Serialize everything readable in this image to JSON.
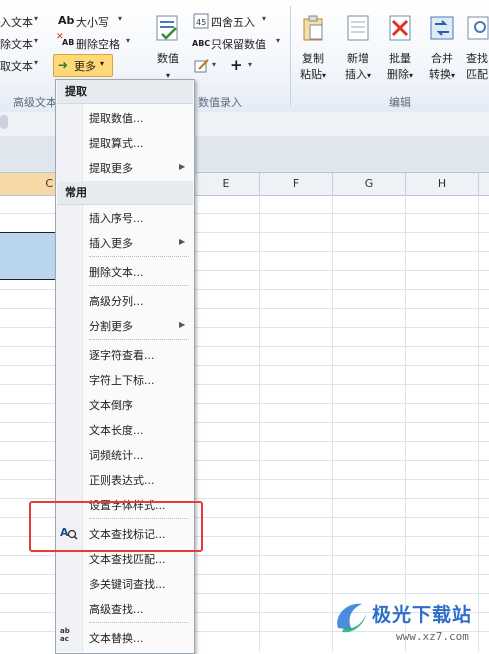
{
  "ribbon": {
    "left_items": [
      "入文本",
      "除文本",
      "取文本"
    ],
    "case_btn": "大小写",
    "case_icon_text": "Ab",
    "delete_space_btn": "删除空格",
    "delete_space_icon_text": "AB",
    "more_btn": "更多",
    "group_label_text": "高级文本",
    "numeric_btn": "数值",
    "round_btn": "四舍五入",
    "keep_numeric_btn": "只保留数值",
    "keep_numeric_icon_text": "ABC",
    "group_label_numeric": "数值录入",
    "copy_paste": [
      "复制",
      "粘贴"
    ],
    "insert": [
      "新增",
      "插入"
    ],
    "batch_delete": [
      "批量",
      "删除"
    ],
    "merge_convert": [
      "合并",
      "转换"
    ],
    "lookup_match": [
      "查找",
      "匹配"
    ],
    "group_label_edit": "编辑"
  },
  "columns": [
    "C",
    "E",
    "F",
    "G",
    "H"
  ],
  "menu": {
    "section_extract": "提取",
    "extract_items": [
      "提取数值...",
      "提取算式...",
      "提取更多"
    ],
    "section_common": "常用",
    "items": [
      "插入序号...",
      "插入更多",
      "删除文本...",
      "高级分列...",
      "分割更多",
      "逐字符查看...",
      "字符上下标...",
      "文本倒序",
      "文本长度...",
      "词频统计...",
      "正则表达式...",
      "设置字体样式...",
      "文本查找标记...",
      "文本查找匹配...",
      "多关键词查找...",
      "高级查找...",
      "文本替换..."
    ],
    "replace_icon_text": "ab ac"
  },
  "watermark": {
    "title": "极光下载站",
    "url": "www.xz7.com"
  },
  "colors": {
    "highlight_box": "#e83a3a",
    "more_button": "#ffd978",
    "selected_cells": "#b9d5ef"
  }
}
